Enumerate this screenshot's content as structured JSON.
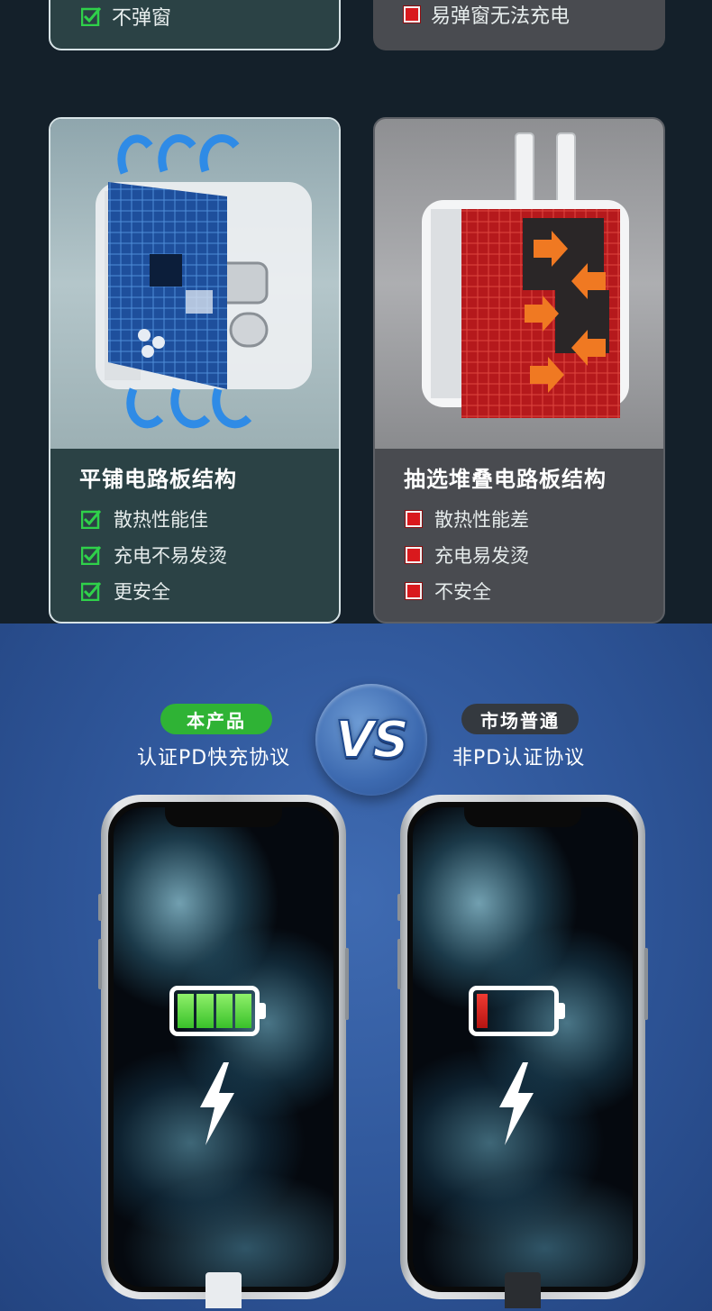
{
  "top_partial": {
    "good_feature": "不弹窗",
    "bad_feature": "易弹窗无法充电"
  },
  "good_card": {
    "title": "平铺电路板结构",
    "features": [
      "散热性能佳",
      "充电不易发烫",
      "更安全"
    ]
  },
  "bad_card": {
    "title": "抽选堆叠电路板结构",
    "features": [
      "散热性能差",
      "充电易发烫",
      "不安全"
    ]
  },
  "comparison": {
    "left_badge": "本产品",
    "left_subtitle": "认证PD快充协议",
    "vs": "VS",
    "right_badge": "市场普通",
    "right_subtitle": "非PD认证协议"
  },
  "colors": {
    "good_accent": "#2fb335",
    "bad_accent": "#d9191d",
    "background_blue": "#2e5598"
  },
  "icons": {
    "good": "green-check-icon",
    "bad": "red-cross-box-icon",
    "charging": "lightning-bolt-icon",
    "battery_full": "battery-full-icon",
    "battery_low": "battery-low-icon"
  }
}
